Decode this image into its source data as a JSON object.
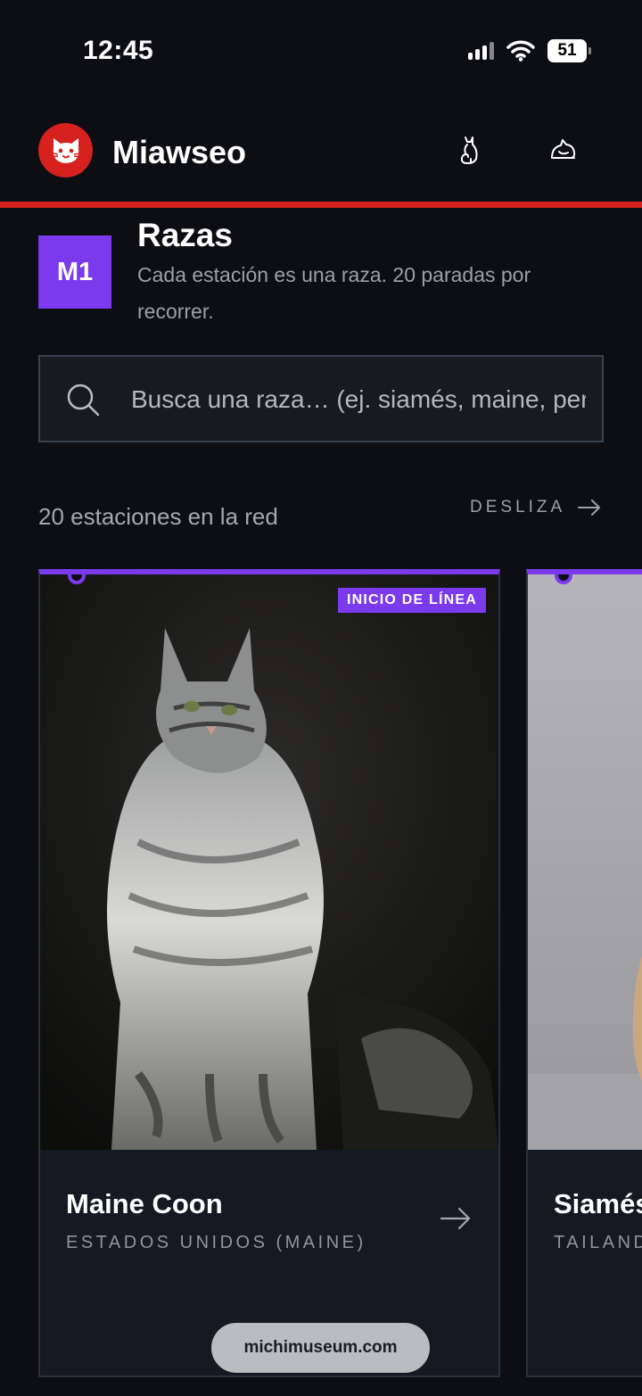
{
  "status": {
    "time": "12:45",
    "battery": "51"
  },
  "header": {
    "app_name": "Miawseo"
  },
  "section": {
    "line_code": "M1",
    "title": "Razas",
    "subtitle": "Cada estación es una raza. 20 paradas por recorrer."
  },
  "search": {
    "placeholder": "Busca una raza… (ej. siamés, maine, persa)"
  },
  "network": {
    "count_label": "20 estaciones en la red",
    "swipe_label": "DESLIZA"
  },
  "cards": [
    {
      "tag": "INICIO DE LÍNEA",
      "name": "Maine Coon",
      "country": "ESTADOS UNIDOS (MAINE)"
    },
    {
      "name": "Siamés",
      "country": "TAILANDIA"
    }
  ],
  "browser": {
    "url": "michimuseum.com"
  },
  "colors": {
    "accent_purple": "#7c3aed",
    "brand_red": "#d7211e",
    "background": "#0c0e13"
  }
}
